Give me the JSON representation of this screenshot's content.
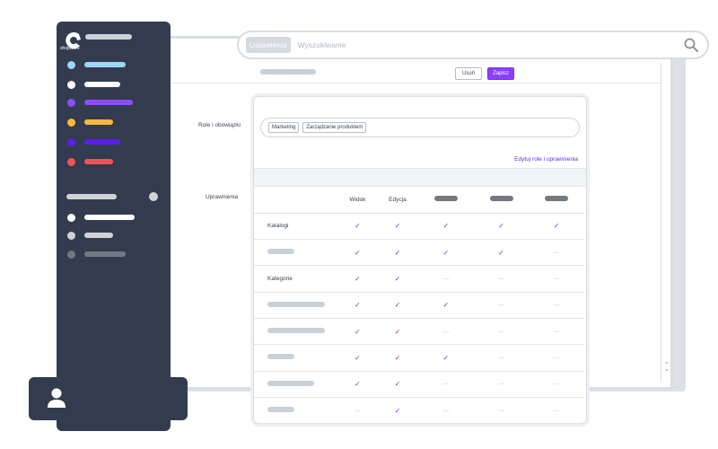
{
  "search": {
    "tag": "Ustawienia",
    "placeholder": "Wyszukiwanie"
  },
  "sidebar": {
    "logo_text": "shopware",
    "items": [
      {
        "color": "#9ed6f5"
      },
      {
        "color": "#ffffff"
      },
      {
        "color": "#8e4cf5"
      },
      {
        "color": "#f6b93b"
      },
      {
        "color": "#5b1fe8"
      },
      {
        "color": "#f05454"
      }
    ],
    "sub_items": [
      {
        "color": "#ffffff"
      },
      {
        "color": "#cfd3d8"
      },
      {
        "color": "#737980"
      }
    ]
  },
  "toolbar": {
    "delete_label": "Usuń",
    "save_label": "Zapisz"
  },
  "form": {
    "roles_label": "Role i obowiązki",
    "permissions_label": "Uprawnienia"
  },
  "roles": {
    "chips": [
      "Marketing",
      "Zarządzanie produktem"
    ],
    "edit_link": "Edytuj role i uprawnienia"
  },
  "permissions": {
    "columns": [
      "Widok",
      "Edycja"
    ],
    "rows": [
      {
        "name": "Katalogi",
        "cells": [
          "check",
          "check",
          "check",
          "check",
          "check"
        ]
      },
      {
        "name": "",
        "cells": [
          "check",
          "check",
          "check",
          "check",
          "dash"
        ]
      },
      {
        "name": "Kategorie",
        "cells": [
          "check",
          "check",
          "dash",
          "dash",
          "dash"
        ]
      },
      {
        "name": "",
        "cells": [
          "check",
          "check",
          "check",
          "dash",
          "dash"
        ]
      },
      {
        "name": "",
        "cells": [
          "check",
          "check",
          "dash",
          "dash",
          "dash"
        ]
      },
      {
        "name": "",
        "cells": [
          "check",
          "check",
          "check",
          "dash",
          "dash"
        ]
      },
      {
        "name": "",
        "cells": [
          "check",
          "check",
          "dash",
          "dash",
          "dash"
        ]
      },
      {
        "name": "",
        "cells": [
          "dash",
          "check",
          "dash",
          "dash",
          "dash"
        ]
      }
    ]
  }
}
